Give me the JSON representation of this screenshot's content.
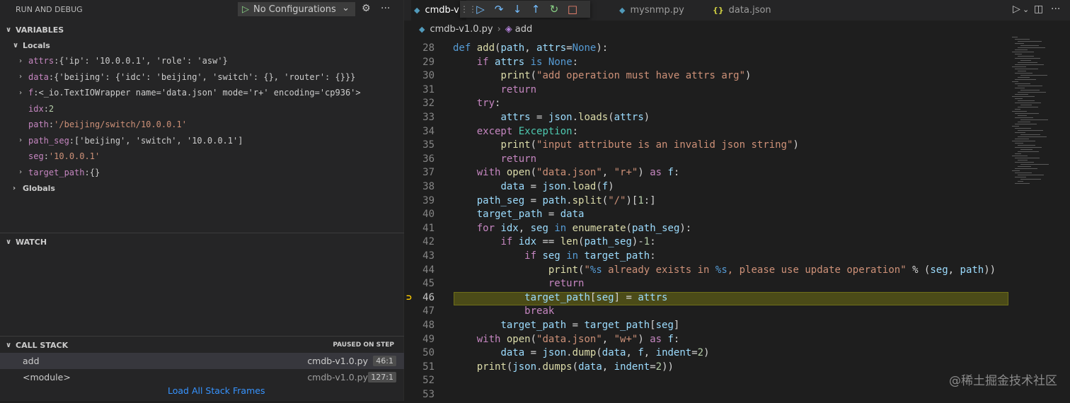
{
  "sidebar": {
    "title": "RUN AND DEBUG",
    "config_label": "No Configurations",
    "variables_title": "VARIABLES",
    "locals_title": "Locals",
    "globals_title": "Globals",
    "variables": [
      {
        "name": "attrs",
        "value": "{'ip': '10.0.0.1', 'role': 'asw'}",
        "kind": "obj",
        "expandable": true
      },
      {
        "name": "data",
        "value": "{'beijing': {'idc': 'beijing', 'switch': {}, 'router': {}}}",
        "kind": "obj",
        "expandable": true
      },
      {
        "name": "f",
        "value": "<_io.TextIOWrapper name='data.json' mode='r+' encoding='cp936'>",
        "kind": "obj",
        "expandable": true
      },
      {
        "name": "idx",
        "value": "2",
        "kind": "num",
        "expandable": false
      },
      {
        "name": "path",
        "value": "'/beijing/switch/10.0.0.1'",
        "kind": "str",
        "expandable": false
      },
      {
        "name": "path_seg",
        "value": "['beijing', 'switch', '10.0.0.1']",
        "kind": "obj",
        "expandable": true
      },
      {
        "name": "seg",
        "value": "'10.0.0.1'",
        "kind": "str",
        "expandable": false
      },
      {
        "name": "target_path",
        "value": "{}",
        "kind": "obj",
        "expandable": true
      }
    ],
    "watch_title": "WATCH",
    "callstack_title": "CALL STACK",
    "paused_label": "PAUSED ON STEP",
    "frames": [
      {
        "name": "add",
        "file": "cmdb-v1.0.py",
        "pos": "46:1"
      },
      {
        "name": "<module>",
        "file": "cmdb-v1.0.py",
        "pos": "127:1"
      }
    ],
    "load_frames": "Load All Stack Frames"
  },
  "tabs": [
    {
      "label": "cmdb-v",
      "icon": "python-icon"
    },
    {
      "label": "mysnmp.py",
      "icon": "python-icon"
    },
    {
      "label": "data.json",
      "icon": "json-icon"
    }
  ],
  "breadcrumb": {
    "file": "cmdb-v1.0.py",
    "symbol": "add"
  },
  "editor": {
    "current_line": 46,
    "lines": [
      {
        "n": "28",
        "html": "<span class='kw'>def</span> <span class='fn'>add</span>(<span class='var'>path</span>, <span class='var'>attrs</span>=<span class='kw'>None</span>):"
      },
      {
        "n": "29",
        "html": "    <span class='kw2'>if</span> <span class='var'>attrs</span> <span class='kw'>is</span> <span class='kw'>None</span>:"
      },
      {
        "n": "30",
        "html": "        <span class='fn'>print</span>(<span class='str'>\"add operation must have attrs arg\"</span>)"
      },
      {
        "n": "31",
        "html": "        <span class='kw2'>return</span>"
      },
      {
        "n": "32",
        "html": "    <span class='kw2'>try</span>:"
      },
      {
        "n": "33",
        "html": "        <span class='var'>attrs</span> = <span class='var'>json</span>.<span class='fn'>loads</span>(<span class='var'>attrs</span>)"
      },
      {
        "n": "34",
        "html": "    <span class='kw2'>except</span> <span class='cls'>Exception</span>:"
      },
      {
        "n": "35",
        "html": "        <span class='fn'>print</span>(<span class='str'>\"input attribute is an invalid json string\"</span>)"
      },
      {
        "n": "36",
        "html": "        <span class='kw2'>return</span>"
      },
      {
        "n": "37",
        "html": "    <span class='kw2'>with</span> <span class='fn'>open</span>(<span class='str'>\"data.json\"</span>, <span class='str'>\"r+\"</span>) <span class='kw2'>as</span> <span class='var'>f</span>:"
      },
      {
        "n": "38",
        "html": "        <span class='var'>data</span> = <span class='var'>json</span>.<span class='fn'>load</span>(<span class='var'>f</span>)"
      },
      {
        "n": "39",
        "html": "    <span class='var'>path_seg</span> = <span class='var'>path</span>.<span class='fn'>split</span>(<span class='str'>\"/\"</span>)[<span class='num'>1</span>:]"
      },
      {
        "n": "40",
        "html": "    <span class='var'>target_path</span> = <span class='var'>data</span>"
      },
      {
        "n": "41",
        "html": "    <span class='kw2'>for</span> <span class='var'>idx</span>, <span class='var'>seg</span> <span class='kw'>in</span> <span class='fn'>enumerate</span>(<span class='var'>path_seg</span>):"
      },
      {
        "n": "42",
        "html": "        <span class='kw2'>if</span> <span class='var'>idx</span> == <span class='fn'>len</span>(<span class='var'>path_seg</span>)-<span class='num'>1</span>:"
      },
      {
        "n": "43",
        "html": "            <span class='kw2'>if</span> <span class='var'>seg</span> <span class='kw'>in</span> <span class='var'>target_path</span>:"
      },
      {
        "n": "44",
        "html": "                <span class='fn'>print</span>(<span class='str'>\"<span class='fmt'>%s</span> already exists in <span class='fmt'>%s</span>, please use update operation\"</span> % (<span class='var'>seg</span>, <span class='var'>path</span>))"
      },
      {
        "n": "45",
        "html": "                <span class='kw2'>return</span>"
      },
      {
        "n": "46",
        "html": "            <span class='var'>target_path</span>[<span class='var'>seg</span>] = <span class='var'>attrs</span>"
      },
      {
        "n": "47",
        "html": "            <span class='kw2'>break</span>"
      },
      {
        "n": "48",
        "html": "        <span class='var'>target_path</span> = <span class='var'>target_path</span>[<span class='var'>seg</span>]"
      },
      {
        "n": "49",
        "html": "    <span class='kw2'>with</span> <span class='fn'>open</span>(<span class='str'>\"data.json\"</span>, <span class='str'>\"w+\"</span>) <span class='kw2'>as</span> <span class='var'>f</span>:"
      },
      {
        "n": "50",
        "html": "        <span class='var'>data</span> = <span class='var'>json</span>.<span class='fn'>dump</span>(<span class='var'>data</span>, <span class='var'>f</span>, <span class='var'>indent</span>=<span class='num'>2</span>)"
      },
      {
        "n": "51",
        "html": "    <span class='fn'>print</span>(<span class='var'>json</span>.<span class='fn'>dumps</span>(<span class='var'>data</span>, <span class='var'>indent</span>=<span class='num'>2</span>))"
      },
      {
        "n": "52",
        "html": ""
      },
      {
        "n": "53",
        "html": ""
      }
    ]
  },
  "watermark": "@稀土掘金技术社区",
  "colors": {
    "accent": "#3794ff",
    "current_line": "#4b4b18",
    "breakpoint": "#ffcc00"
  }
}
